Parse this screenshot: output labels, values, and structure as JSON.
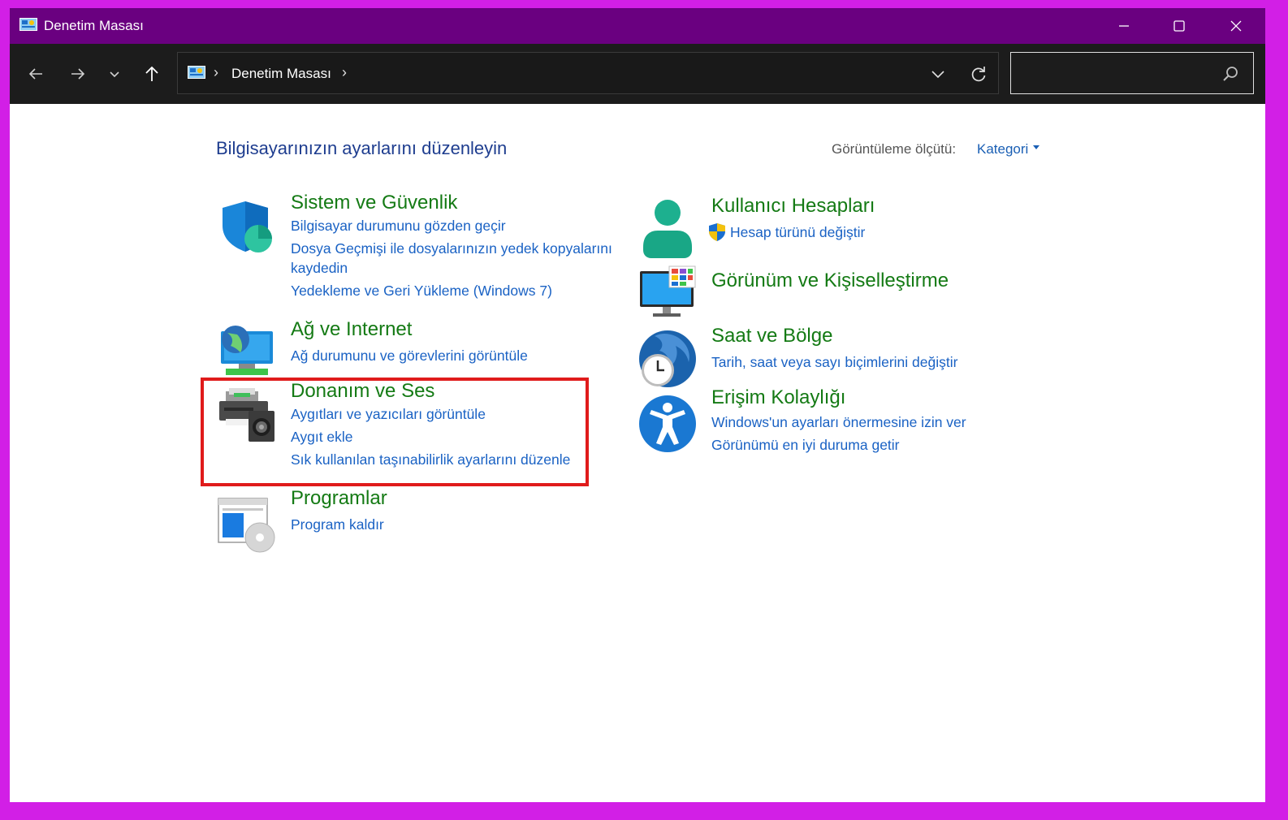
{
  "window": {
    "title": "Denetim Masası",
    "icon": "control-panel-icon"
  },
  "window_controls": [
    "minimize-icon",
    "maximize-icon",
    "close-icon"
  ],
  "nav": {
    "back_icon": "arrow-left-icon",
    "forward_icon": "arrow-right-icon",
    "recent_icon": "chevron-down-icon",
    "up_icon": "arrow-up-icon"
  },
  "address": {
    "crumb": "Denetim Masası",
    "separator": "›"
  },
  "search": {
    "value": "",
    "placeholder": ""
  },
  "main": {
    "heading": "Bilgisayarınızın ayarlarını düzenleyin",
    "view_by_label": "Görüntüleme ölçütü:",
    "view_by_value": "Kategori"
  },
  "categories": [
    {
      "title": "Sistem ve Güvenlik",
      "icon": "shield-icon",
      "links": [
        "Bilgisayar durumunu gözden geçir",
        "Dosya Geçmişi ile dosyalarınızın yedek kopyalarını",
        "kaydedin",
        "Yedekleme ve Geri Yükleme (Windows 7)"
      ]
    },
    {
      "title": "Ağ ve Internet",
      "icon": "network-globe-icon",
      "links": [
        "Ağ durumunu ve görevlerini görüntüle"
      ]
    },
    {
      "title": "Donanım ve Ses",
      "icon": "printer-speaker-icon",
      "links": [
        "Aygıtları ve yazıcıları görüntüle",
        "Aygıt ekle",
        "Sık kullanılan taşınabilirlik ayarlarını düzenle"
      ]
    },
    {
      "title": "Programlar",
      "icon": "programs-disc-icon",
      "links": [
        "Program kaldır"
      ]
    },
    {
      "title": "Kullanıcı Hesapları",
      "icon": "user-icon",
      "links": [
        "Hesap türünü değiştir"
      ]
    },
    {
      "title": "Görünüm ve Kişiselleştirme",
      "icon": "monitor-personalization-icon",
      "links": []
    },
    {
      "title": "Saat ve Bölge",
      "icon": "clock-globe-icon",
      "links": [
        "Tarih, saat veya sayı biçimlerini değiştir"
      ]
    },
    {
      "title": "Erişim Kolaylığı",
      "icon": "accessibility-icon",
      "links": [
        "Windows'un ayarları önermesine izin ver",
        "Görünümü en iyi duruma getir"
      ]
    }
  ],
  "colors": {
    "titlebar": "#6a0080",
    "frame": "#d21fe6",
    "category_title": "#147a14",
    "link": "#1a62c4",
    "highlight": "#e01b1b"
  }
}
